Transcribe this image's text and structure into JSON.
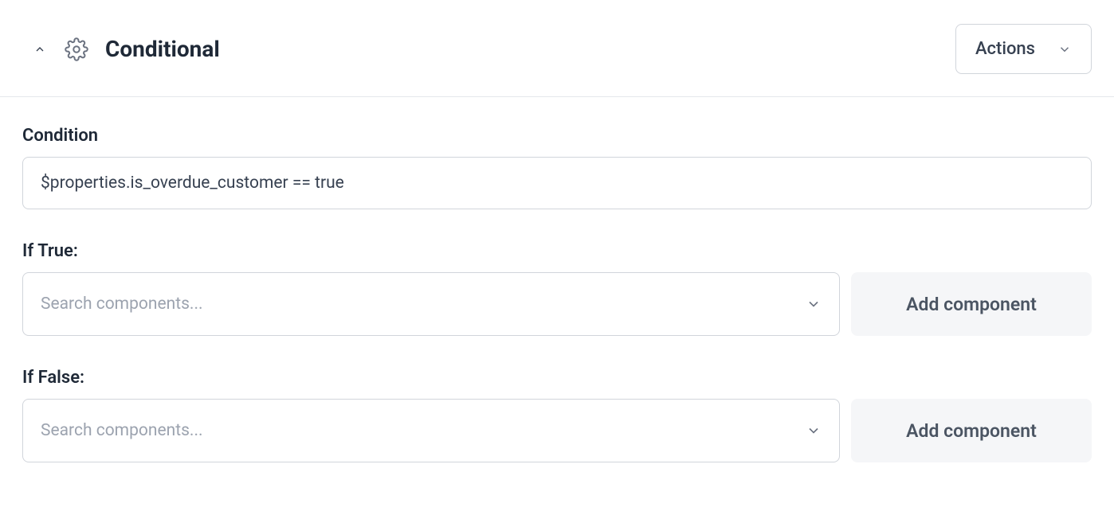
{
  "header": {
    "title": "Conditional",
    "actions_label": "Actions"
  },
  "condition": {
    "label": "Condition",
    "value": "$properties.is_overdue_customer == true"
  },
  "if_true": {
    "label": "If True:",
    "placeholder": "Search components...",
    "add_label": "Add component"
  },
  "if_false": {
    "label": "If False:",
    "placeholder": "Search components...",
    "add_label": "Add component"
  }
}
